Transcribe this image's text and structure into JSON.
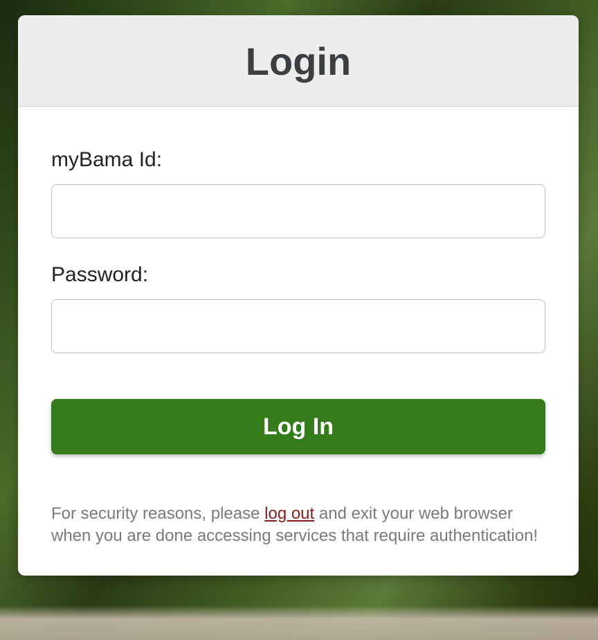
{
  "header": {
    "title": "Login"
  },
  "form": {
    "username_label": "myBama Id:",
    "username_value": "",
    "password_label": "Password:",
    "password_value": "",
    "submit_label": "Log In"
  },
  "notice": {
    "prefix": "For security reasons, please ",
    "link_text": "log out",
    "suffix": " and exit your web browser when you are done accessing services that require authentication!"
  },
  "colors": {
    "button_bg": "#347b1a",
    "link_color": "#8b1a1a",
    "header_bg": "#ededed"
  }
}
